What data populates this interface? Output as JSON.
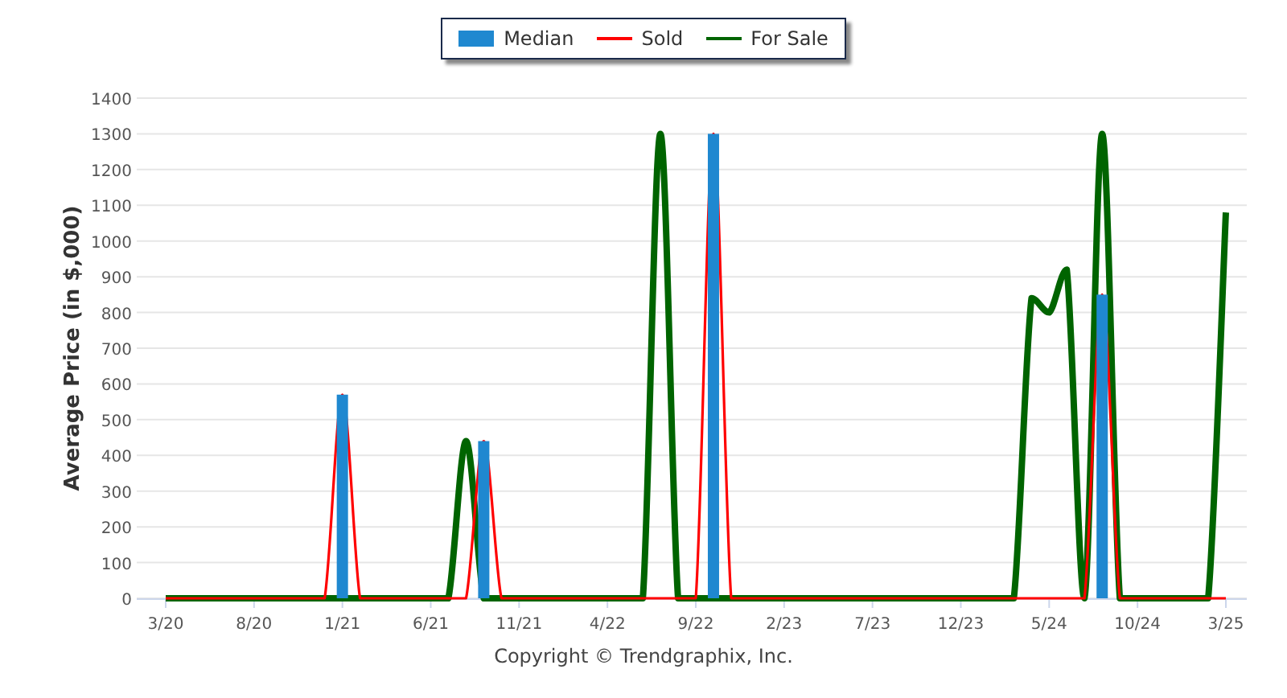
{
  "chart_data": {
    "type": "line",
    "ylabel": "Average Price (in $,000)",
    "grid": true,
    "categories": [
      "3/20",
      null,
      null,
      null,
      null,
      "8/20",
      null,
      null,
      null,
      null,
      "1/21",
      null,
      null,
      null,
      null,
      "6/21",
      null,
      null,
      null,
      null,
      "11/21",
      null,
      null,
      null,
      null,
      "4/22",
      null,
      null,
      null,
      null,
      "9/22",
      null,
      null,
      null,
      null,
      "2/23",
      null,
      null,
      null,
      null,
      "7/23",
      null,
      null,
      null,
      null,
      "12/23",
      null,
      null,
      null,
      null,
      "5/24",
      null,
      null,
      null,
      null,
      "10/24",
      null,
      null,
      null,
      null,
      "3/25"
    ],
    "ylim": [
      0,
      1400
    ],
    "yticks": [
      0,
      100,
      200,
      300,
      400,
      500,
      600,
      700,
      800,
      900,
      1000,
      1100,
      1200,
      1300,
      1400
    ],
    "series": [
      {
        "name": "Median",
        "type": "bar",
        "color": "#1f88d0",
        "values": [
          null,
          null,
          null,
          null,
          null,
          null,
          null,
          null,
          null,
          null,
          570,
          null,
          null,
          null,
          null,
          null,
          null,
          null,
          440,
          null,
          null,
          null,
          null,
          null,
          null,
          null,
          null,
          null,
          null,
          null,
          null,
          1300,
          null,
          null,
          null,
          null,
          null,
          null,
          null,
          null,
          null,
          null,
          null,
          null,
          null,
          null,
          null,
          null,
          null,
          null,
          null,
          null,
          null,
          850,
          null,
          null,
          null,
          null,
          null,
          null,
          null
        ]
      },
      {
        "name": "Sold",
        "type": "line",
        "color": "#ff0000",
        "values": [
          0,
          0,
          0,
          0,
          0,
          0,
          0,
          0,
          0,
          0,
          570,
          0,
          0,
          0,
          0,
          0,
          0,
          0,
          440,
          0,
          0,
          0,
          0,
          0,
          0,
          0,
          0,
          0,
          0,
          0,
          0,
          1300,
          0,
          0,
          0,
          0,
          0,
          0,
          0,
          0,
          0,
          0,
          0,
          0,
          0,
          0,
          0,
          0,
          0,
          0,
          0,
          0,
          0,
          850,
          0,
          0,
          0,
          0,
          0,
          0,
          0
        ]
      },
      {
        "name": "For Sale",
        "type": "line",
        "color": "#006400",
        "values": [
          0,
          0,
          0,
          0,
          0,
          0,
          0,
          0,
          0,
          0,
          0,
          0,
          0,
          0,
          0,
          0,
          0,
          440,
          0,
          0,
          0,
          0,
          0,
          0,
          0,
          0,
          0,
          0,
          1300,
          0,
          0,
          0,
          0,
          0,
          0,
          0,
          0,
          0,
          0,
          0,
          0,
          0,
          0,
          0,
          0,
          0,
          0,
          0,
          0,
          840,
          800,
          920,
          0,
          1300,
          0,
          0,
          0,
          0,
          0,
          0,
          1080
        ]
      }
    ]
  },
  "footer": "Copyright © Trendgraphix, Inc."
}
